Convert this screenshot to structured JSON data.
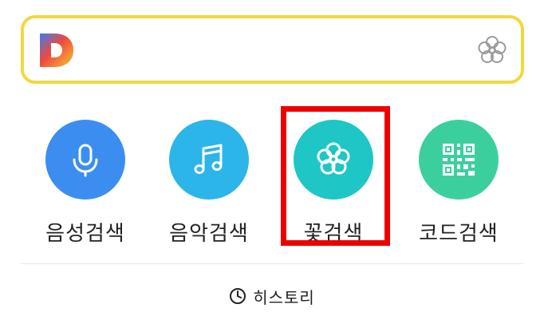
{
  "search": {
    "value": "",
    "placeholder": ""
  },
  "actions": [
    {
      "label": "음성검색",
      "color": "#3b8ef0",
      "icon": "microphone-icon"
    },
    {
      "label": "음악검색",
      "color": "#2cb5e8",
      "icon": "music-note-icon"
    },
    {
      "label": "꽃검색",
      "color": "#1ec6c6",
      "icon": "flower-icon"
    },
    {
      "label": "코드검색",
      "color": "#3ccf9e",
      "icon": "qr-code-icon"
    }
  ],
  "history": {
    "label": "히스토리",
    "icon": "clock-icon"
  },
  "colors": {
    "search_border": "#f2d93a",
    "highlight": "#ee0000"
  }
}
